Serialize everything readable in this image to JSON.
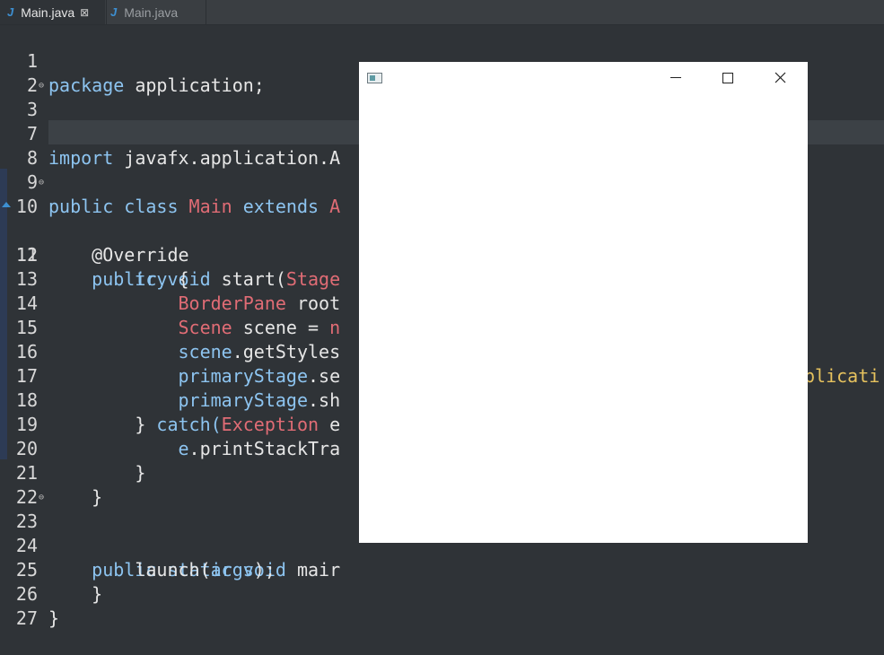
{
  "tabs": [
    {
      "icon": "java-file-icon",
      "label": "Main.java",
      "close": "⊠"
    },
    {
      "icon": "java-file-icon",
      "label": "Main.java"
    }
  ],
  "tab_icon_letter": "J",
  "code": {
    "l1": {
      "num": "1",
      "a": "package",
      "b": " application;"
    },
    "l2": {
      "num": "2"
    },
    "l3": {
      "num": "3",
      "a": "import",
      "b": " javafx.application.A"
    },
    "l7": {
      "num": "7"
    },
    "l8": {
      "num": "8"
    },
    "l9": {
      "num": "9",
      "a": "public class ",
      "b": "Main",
      "c": " extends ",
      "d": "A"
    },
    "l10": {
      "num": "10",
      "a": "    @Override"
    },
    "l11": {
      "num": "11",
      "a": "    public void ",
      "b": "start(",
      "c": "Stage"
    },
    "l12": {
      "num": "12",
      "a": "        try ",
      "b": "{"
    },
    "l13": {
      "num": "13",
      "a": "            ",
      "b": "BorderPane",
      "c": " root"
    },
    "l14": {
      "num": "14",
      "a": "            ",
      "b": "Scene",
      "c": " scene = ",
      "d": "n"
    },
    "l15": {
      "num": "15",
      "a": "            ",
      "b": "scene",
      "c": ".getStyles",
      "d": "plicati"
    },
    "l16": {
      "num": "16",
      "a": "            ",
      "b": "primaryStage",
      "c": ".se"
    },
    "l17": {
      "num": "17",
      "a": "            ",
      "b": "primaryStage",
      "c": ".sh"
    },
    "l18": {
      "num": "18",
      "a": "        } ",
      "b": "catch(",
      "c": "Exception",
      "d": " e"
    },
    "l19": {
      "num": "19",
      "a": "            ",
      "b": "e",
      "c": ".printStackTra"
    },
    "l20": {
      "num": "20",
      "a": "        }"
    },
    "l21": {
      "num": "21",
      "a": "    }"
    },
    "l22": {
      "num": "22"
    },
    "l23": {
      "num": "23",
      "a": "    public static void ",
      "b": "mair"
    },
    "l24": {
      "num": "24",
      "a": "        launch(",
      "b": "args",
      "c": ");"
    },
    "l25": {
      "num": "25",
      "a": "    }"
    },
    "l26": {
      "num": "26",
      "a": "}"
    },
    "l27": {
      "num": "27"
    }
  },
  "window": {
    "app_icon": "window-app-icon",
    "minimize_icon": "minimize-icon",
    "maximize_icon": "maximize-icon",
    "close_icon": "close-icon"
  },
  "colors": {
    "editor_bg": "#2f3337",
    "keyword": "#8dc4f0",
    "type": "#e06c75",
    "string": "#e6c25e",
    "line_number": "#d8d8d8"
  }
}
